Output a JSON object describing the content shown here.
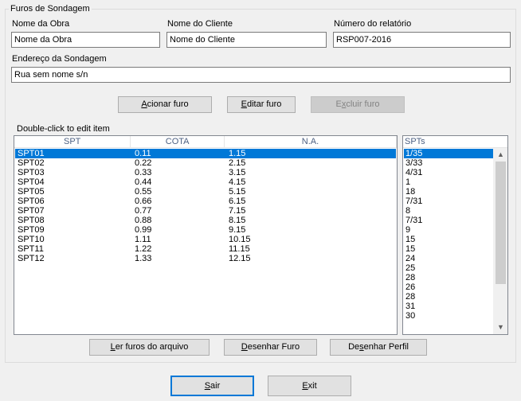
{
  "group": {
    "title": "Furos de Sondagem"
  },
  "fields": {
    "obra": {
      "label": "Nome da Obra",
      "value": "Nome da Obra"
    },
    "cliente": {
      "label": "Nome do Cliente",
      "value": "Nome do Cliente"
    },
    "relatorio": {
      "label": "Número do relatório",
      "value": "RSP007-2016"
    },
    "endereco": {
      "label": "Endereço da Sondagem",
      "value": "Rua sem nome s/n"
    }
  },
  "buttons": {
    "add": {
      "pre": "",
      "acc": "A",
      "post": "cionar furo"
    },
    "edit": {
      "pre": "",
      "acc": "E",
      "post": "ditar furo"
    },
    "delete": {
      "pre": "E",
      "acc": "x",
      "post": "cluir furo"
    },
    "read": {
      "pre": "",
      "acc": "L",
      "post": "er furos do arquivo"
    },
    "draw": {
      "pre": "",
      "acc": "D",
      "post": "esenhar Furo"
    },
    "profile": {
      "pre": "De",
      "acc": "s",
      "post": "enhar Perfil"
    },
    "sair": {
      "pre": "",
      "acc": "S",
      "post": "air"
    },
    "exit": {
      "pre": "",
      "acc": "E",
      "post": "xit"
    }
  },
  "hint": "Double-click to edit item",
  "table": {
    "columns": [
      "SPT",
      "COTA",
      "N.A."
    ],
    "rows": [
      [
        "SPT01",
        "0.11",
        "1.15"
      ],
      [
        "SPT02",
        "0.22",
        "2.15"
      ],
      [
        "SPT03",
        "0.33",
        "3.15"
      ],
      [
        "SPT04",
        "0.44",
        "4.15"
      ],
      [
        "SPT05",
        "0.55",
        "5.15"
      ],
      [
        "SPT06",
        "0.66",
        "6.15"
      ],
      [
        "SPT07",
        "0.77",
        "7.15"
      ],
      [
        "SPT08",
        "0.88",
        "8.15"
      ],
      [
        "SPT09",
        "0.99",
        "9.15"
      ],
      [
        "SPT10",
        "1.11",
        "10.15"
      ],
      [
        "SPT11",
        "1.22",
        "11.15"
      ],
      [
        "SPT12",
        "1.33",
        "12.15"
      ]
    ]
  },
  "spts": {
    "header": "SPTs",
    "items": [
      "1/35",
      "3/33",
      "4/31",
      "1",
      "18",
      "7/31",
      "8",
      "7/31",
      "9",
      "15",
      "15",
      "24",
      "25",
      "28",
      "26",
      "28",
      "31",
      "30"
    ]
  },
  "colors": {
    "selection": "#0078d7",
    "accent": "#0078d7"
  }
}
